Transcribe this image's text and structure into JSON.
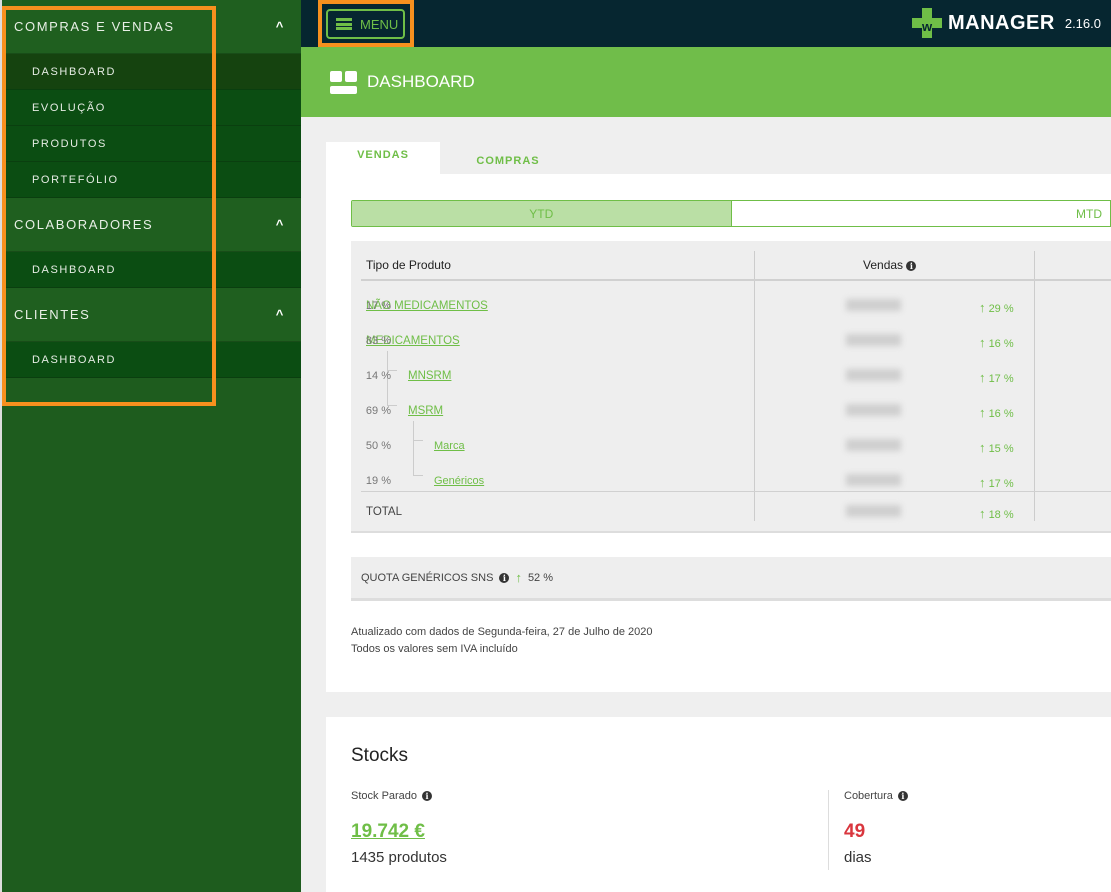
{
  "sidebar": {
    "sections": [
      {
        "label": "COMPRAS E VENDAS",
        "items": [
          "DASHBOARD",
          "EVOLUÇÃO",
          "PRODUTOS",
          "PORTEFÓLIO"
        ]
      },
      {
        "label": "COLABORADORES",
        "items": [
          "DASHBOARD"
        ]
      },
      {
        "label": "CLIENTES",
        "items": [
          "DASHBOARD"
        ]
      }
    ]
  },
  "topbar": {
    "menu_label": "MENU",
    "brand": "MANAGER",
    "version": "2.16.0"
  },
  "page_title": "DASHBOARD",
  "tabs": [
    "VENDAS",
    "COMPRAS"
  ],
  "period_toggle": {
    "options": [
      "YTD",
      "MTD"
    ],
    "selected": "YTD"
  },
  "table": {
    "headers": {
      "type": "Tipo de Produto",
      "sales": "Vendas"
    },
    "rows": [
      {
        "name": "NÃO MEDICAMENTOS",
        "share": "17 %",
        "growth": "29 %"
      },
      {
        "name": "MEDICAMENTOS",
        "share": "83 %",
        "growth": "16 %"
      },
      {
        "name": "MNSRM",
        "share": "14 %",
        "growth": "17 %"
      },
      {
        "name": "MSRM",
        "share": "69 %",
        "growth": "16 %"
      },
      {
        "name": "Marca",
        "share": "50 %",
        "growth": "15 %"
      },
      {
        "name": "Genéricos",
        "share": "19 %",
        "growth": "17 %"
      }
    ],
    "total": {
      "label": "TOTAL",
      "growth": "18 %"
    }
  },
  "quota": {
    "label": "QUOTA GENÉRICOS SNS",
    "value": "52 %"
  },
  "notes": [
    "Atualizado com dados de Segunda-feira, 27 de Julho de 2020",
    "Todos os valores sem IVA incluído"
  ],
  "stocks": {
    "title": "Stocks",
    "stock_parado": {
      "label": "Stock Parado",
      "value": "19.742 €",
      "sub": "1435 produtos"
    },
    "cobertura": {
      "label": "Cobertura",
      "value": "49",
      "sub": "dias"
    }
  },
  "colors": {
    "accent": "#6fbe47",
    "sidebar": "#1e5c1e",
    "topbar": "#062630",
    "negative": "#d9363e",
    "highlight": "#f7901e"
  }
}
